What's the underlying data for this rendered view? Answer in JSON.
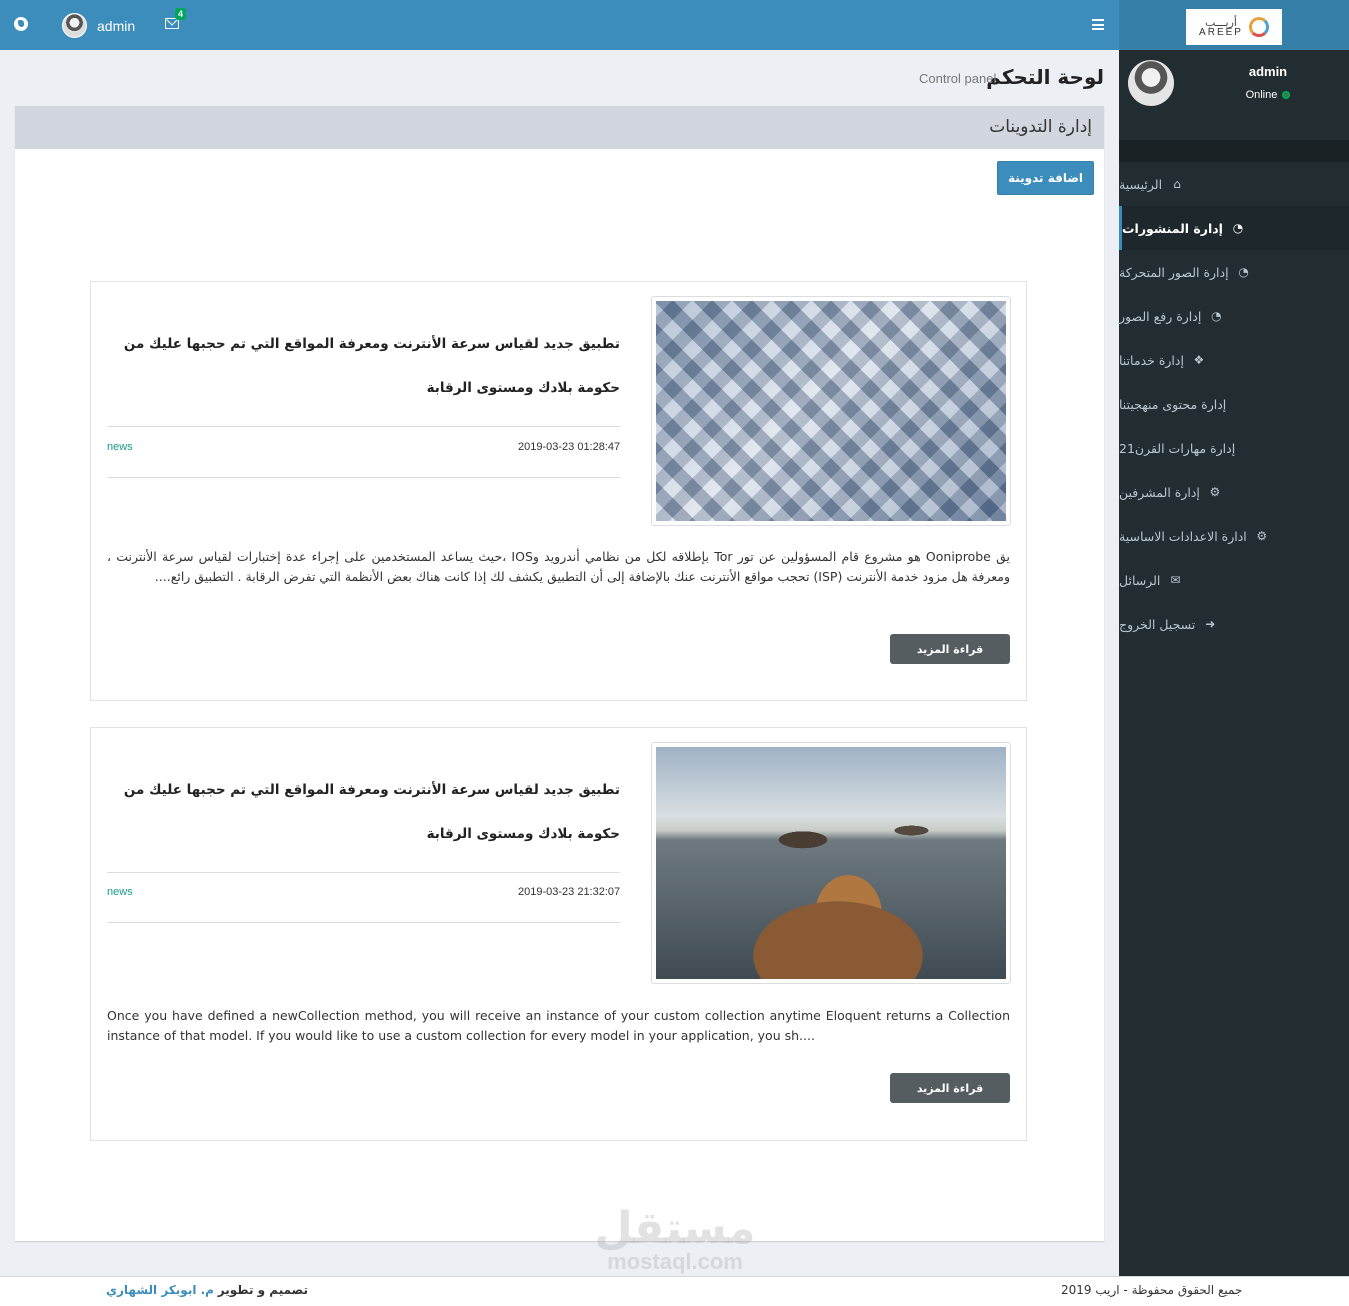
{
  "header": {
    "username": "admin",
    "mail_count": "4"
  },
  "sidebar": {
    "logo_ar": "أريـــب",
    "logo_en": "AREEP",
    "user_name": "admin",
    "user_status": "Online",
    "items": [
      {
        "label": "الرئيسية",
        "icon": "home-icon",
        "glyph": "⌂",
        "active": false
      },
      {
        "label": "إدارة المنشورات",
        "icon": "dashboard-icon",
        "glyph": "◔",
        "active": true
      },
      {
        "label": "إدارة الصور المتحركة",
        "icon": "dashboard-icon",
        "glyph": "◔",
        "active": false
      },
      {
        "label": "إدارة رفع الصور",
        "icon": "dashboard-icon",
        "glyph": "◔",
        "active": false
      },
      {
        "label": "إدارة خدماتنا",
        "icon": "cubes-icon",
        "glyph": "❖",
        "active": false
      },
      {
        "label": "إدارة محتوى منهجيتنا",
        "icon": "",
        "glyph": "",
        "active": false
      },
      {
        "label": "إدارة مهارات القرن21",
        "icon": "",
        "glyph": "",
        "active": false
      },
      {
        "label": "إدارة المشرفين",
        "icon": "gears-icon",
        "glyph": "⚙",
        "active": false
      },
      {
        "label": "ادارة الاعدادات الاساسية",
        "icon": "gear-icon",
        "glyph": "⚙",
        "active": false
      },
      {
        "label": "الرسائل",
        "icon": "envelope-icon",
        "glyph": "✉",
        "active": false
      },
      {
        "label": "تسجيل الخروج",
        "icon": "sign-out-icon",
        "glyph": "➜",
        "active": false
      }
    ]
  },
  "content": {
    "title": "لوحة التحكم",
    "subtitle": "Control panel",
    "box_title": "إدارة التدوينات",
    "add_button": "اضافة تدوينة"
  },
  "posts": [
    {
      "title": "تطبيق جديد لقياس سرعة الأنترنت ومعرفة المواقع التي تم حجبها عليك من حكومة بلادك ومستوى الرقابة",
      "date": "2019-03-23 01:28:47",
      "tag": "news",
      "excerpt": "يق Ooniprobe هو مشروع قام المسؤولين عن تور Tor بإطلاقه لكل من نظامي أندرويد وIOS ،حيث يساعد المستخدمين على إجراء عدة إختبارات لقياس سرعة الأنترنت ، ومعرفة هل مزود خدمة الأنترنت (ISP) تحجب مواقع الأنترنت عنك بالإضافة إلى أن التطبيق يكشف لك إذا كانت هناك بعض الأنظمة التي تفرض الرقابة . التطبيق رائع....",
      "read_more": "قراءة المزيد"
    },
    {
      "title": "تطبيق جديد لقياس سرعة الأنترنت ومعرفة المواقع التي تم حجبها عليك من حكومة بلادك ومستوى الرقابة",
      "date": "2019-03-23 21:32:07",
      "tag": "news",
      "excerpt": "Once you have defined a newCollection method, you will receive an instance of your custom collection anytime Eloquent returns a Collection instance of that model. If you would like to use a custom collection for every model in your application, you sh....",
      "read_more": "قراءة المزيد"
    }
  ],
  "footer": {
    "copyright": "جميع الحقوق محفوظة - اريب 2019",
    "design_label": "تصميم و تطوير",
    "designer": "م. ابوبكر الشهاري"
  },
  "watermark": {
    "ar": "مستقل",
    "en": "mostaql.com"
  }
}
